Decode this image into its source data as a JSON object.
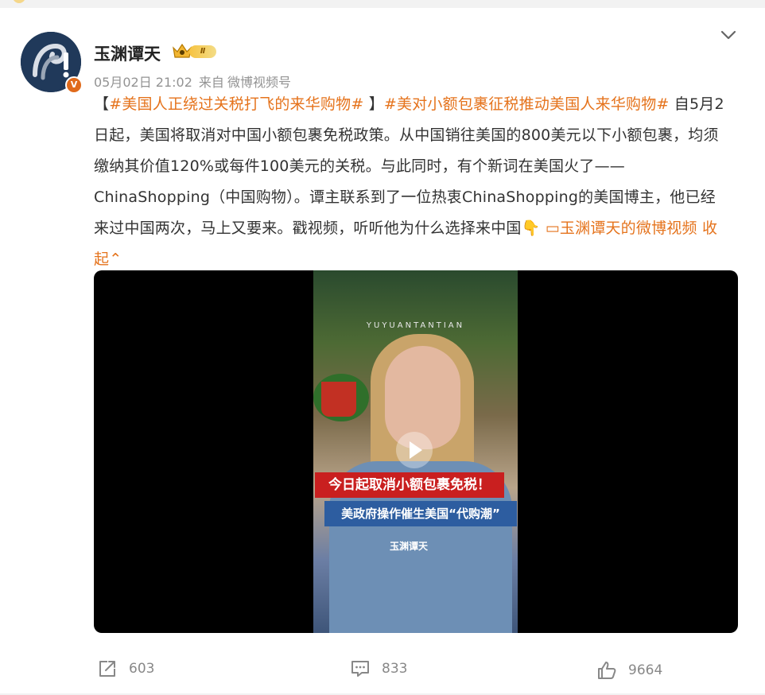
{
  "post": {
    "author": "玉渊谭天",
    "level": "Ⅱ",
    "verified_mark": "V",
    "timestamp": "05月02日 21:02",
    "source_prefix": "来自",
    "source": "微博视频号",
    "text": {
      "bracket_open": "【",
      "topic1": "#美国人正绕过关税打飞的来华购物#",
      "bracket_close": " 】",
      "topic2": "#美对小额包裹征税推动美国人来华购物#",
      "body": " 自5月2日起，美国将取消对中国小额包裹免税政策。从中国销往美国的800美元以下小额包裹，均须缴纳其价值120%或每件100美元的关税。与此同时，有个新词在美国火了——ChinaShopping（中国购物）。谭主联系到了一位热衷ChinaShopping的美国博主，他已经来过中国两次，马上又要来。戳视频，听听他为什么选择来中国",
      "emoji": "👇",
      "video_link_icon": "▭",
      "video_link": "玉渊谭天的微博视频",
      "collapse": "收起",
      "collapse_icon": "⌃"
    },
    "video": {
      "watermark": "YUYUANTANTIAN",
      "caption1": "今日起取消小额包裹免税！",
      "caption2": "美政府操作催生美国“代购潮”",
      "logo": "玉渊谭天"
    },
    "actions": {
      "repost_count": "603",
      "comment_count": "833",
      "like_count": "9664"
    }
  },
  "icons": {
    "more": "chevron-down-icon",
    "repost": "share-icon",
    "comment": "comment-icon",
    "like": "thumbs-up-icon"
  },
  "colors": {
    "link": "#e5731c",
    "verified": "#e06a1b",
    "muted": "#939393"
  }
}
